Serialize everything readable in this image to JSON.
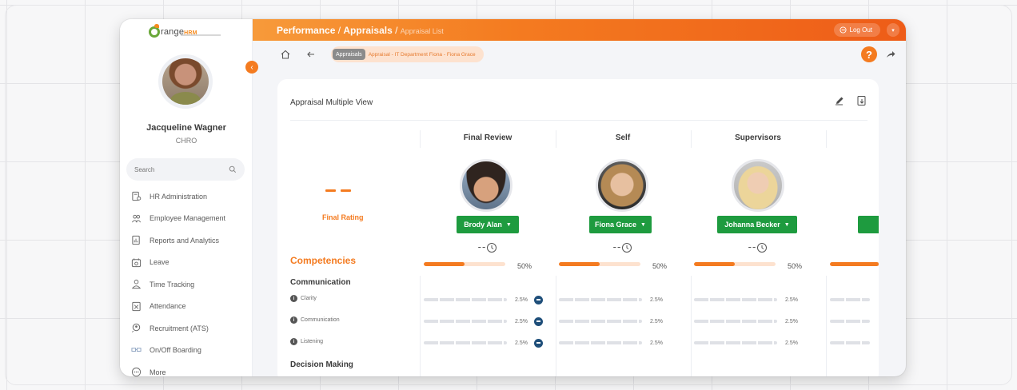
{
  "brand": {
    "logo_text": "range",
    "logo_suffix": "HRM",
    "accent": "#f47b20",
    "green": "#1e9b3f"
  },
  "sidebar": {
    "user_name": "Jacqueline Wagner",
    "user_role": "CHRO",
    "search_placeholder": "Search",
    "items": [
      {
        "label": "HR Administration",
        "icon": "hr-admin-icon"
      },
      {
        "label": "Employee Management",
        "icon": "employee-management-icon"
      },
      {
        "label": "Reports and Analytics",
        "icon": "reports-icon"
      },
      {
        "label": "Leave",
        "icon": "leave-icon"
      },
      {
        "label": "Time Tracking",
        "icon": "time-tracking-icon"
      },
      {
        "label": "Attendance",
        "icon": "attendance-icon"
      },
      {
        "label": "Recruitment (ATS)",
        "icon": "recruitment-icon"
      },
      {
        "label": "On/Off Boarding",
        "icon": "onboarding-icon"
      },
      {
        "label": "More",
        "icon": "more-icon"
      }
    ]
  },
  "topbar": {
    "crumb_1": "Performance",
    "crumb_sep_1": " / ",
    "crumb_2": "Appraisals",
    "crumb_sep_2": " / ",
    "crumb_3": "Appraisal List",
    "logout_label": "Log Out"
  },
  "subbar": {
    "tooltip": "Appraisals",
    "breadcrumb": "Appraisal - IT Department Fiona - Fiona Grace"
  },
  "card": {
    "title": "Appraisal Multiple View",
    "final_rating_label": "Final Rating",
    "competencies_label": "Competencies",
    "columns": [
      {
        "header": "Final Review",
        "reviewer": "Brody Alan",
        "rating": "--",
        "progress": 50,
        "progress_label": "50%"
      },
      {
        "header": "Self",
        "reviewer": "Fiona Grace",
        "rating": "--",
        "progress": 50,
        "progress_label": "50%"
      },
      {
        "header": "Supervisors",
        "reviewer": "Johanna Becker",
        "rating": "--",
        "progress": 50,
        "progress_label": "50%"
      }
    ],
    "sections": [
      {
        "title": "Communication",
        "rows": [
          {
            "label": "Clarity",
            "values": [
              "2.5%",
              "2.5%",
              "2.5%"
            ]
          },
          {
            "label": "Communication",
            "values": [
              "2.5%",
              "2.5%",
              "2.5%"
            ]
          },
          {
            "label": "Listening",
            "values": [
              "2.5%",
              "2.5%",
              "2.5%"
            ]
          }
        ]
      },
      {
        "title": "Decision Making",
        "rows": []
      }
    ]
  }
}
